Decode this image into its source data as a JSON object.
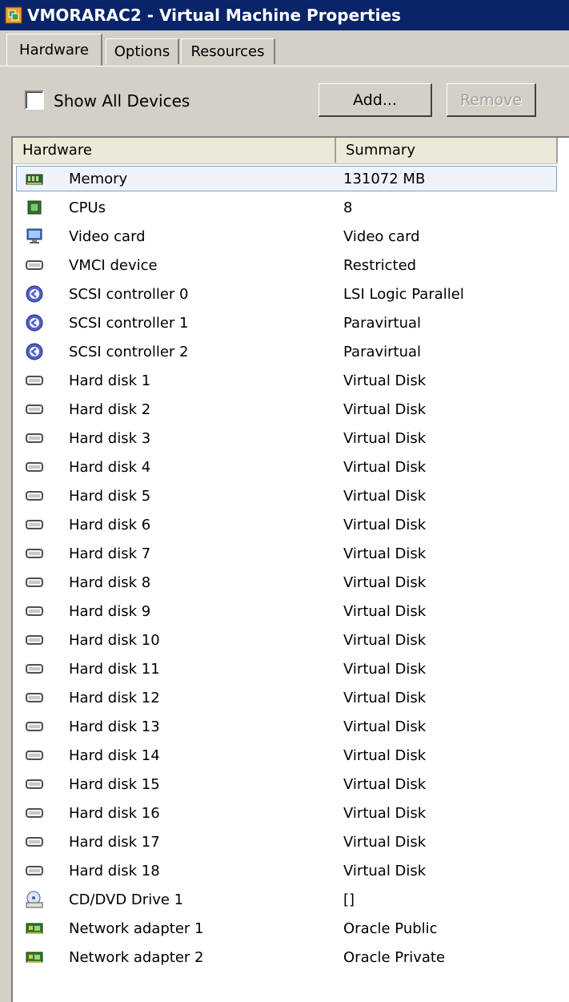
{
  "window": {
    "title": "VMORARAC2 - Virtual Machine Properties"
  },
  "tabs": [
    {
      "label": "Hardware",
      "active": true
    },
    {
      "label": "Options",
      "active": false
    },
    {
      "label": "Resources",
      "active": false
    }
  ],
  "toolbar": {
    "show_all_label": "Show All Devices",
    "show_all_checked": false,
    "add_label": "Add...",
    "remove_label": "Remove"
  },
  "columns": {
    "hardware": "Hardware",
    "summary": "Summary"
  },
  "devices": [
    {
      "name": "Memory",
      "summary": "131072 MB",
      "icon": "memory-icon",
      "selected": true
    },
    {
      "name": "CPUs",
      "summary": "8",
      "icon": "cpu-icon"
    },
    {
      "name": "Video card",
      "summary": "Video card",
      "icon": "monitor-icon"
    },
    {
      "name": "VMCI device",
      "summary": "Restricted",
      "icon": "disk-icon"
    },
    {
      "name": "SCSI controller 0",
      "summary": "LSI Logic Parallel",
      "icon": "scsi-icon"
    },
    {
      "name": "SCSI controller 1",
      "summary": "Paravirtual",
      "icon": "scsi-icon"
    },
    {
      "name": "SCSI controller 2",
      "summary": "Paravirtual",
      "icon": "scsi-icon"
    },
    {
      "name": "Hard disk 1",
      "summary": "Virtual Disk",
      "icon": "disk-icon"
    },
    {
      "name": "Hard disk 2",
      "summary": "Virtual Disk",
      "icon": "disk-icon"
    },
    {
      "name": "Hard disk 3",
      "summary": "Virtual Disk",
      "icon": "disk-icon"
    },
    {
      "name": "Hard disk 4",
      "summary": "Virtual Disk",
      "icon": "disk-icon"
    },
    {
      "name": "Hard disk 5",
      "summary": "Virtual Disk",
      "icon": "disk-icon"
    },
    {
      "name": "Hard disk 6",
      "summary": "Virtual Disk",
      "icon": "disk-icon"
    },
    {
      "name": "Hard disk 7",
      "summary": "Virtual Disk",
      "icon": "disk-icon"
    },
    {
      "name": "Hard disk 8",
      "summary": "Virtual Disk",
      "icon": "disk-icon"
    },
    {
      "name": "Hard disk 9",
      "summary": "Virtual Disk",
      "icon": "disk-icon"
    },
    {
      "name": "Hard disk 10",
      "summary": "Virtual Disk",
      "icon": "disk-icon"
    },
    {
      "name": "Hard disk 11",
      "summary": "Virtual Disk",
      "icon": "disk-icon"
    },
    {
      "name": "Hard disk 12",
      "summary": "Virtual Disk",
      "icon": "disk-icon"
    },
    {
      "name": "Hard disk 13",
      "summary": "Virtual Disk",
      "icon": "disk-icon"
    },
    {
      "name": "Hard disk 14",
      "summary": "Virtual Disk",
      "icon": "disk-icon"
    },
    {
      "name": "Hard disk 15",
      "summary": "Virtual Disk",
      "icon": "disk-icon"
    },
    {
      "name": "Hard disk 16",
      "summary": "Virtual Disk",
      "icon": "disk-icon"
    },
    {
      "name": "Hard disk 17",
      "summary": "Virtual Disk",
      "icon": "disk-icon"
    },
    {
      "name": "Hard disk 18",
      "summary": "Virtual Disk",
      "icon": "disk-icon"
    },
    {
      "name": "CD/DVD Drive 1",
      "summary": "[]",
      "icon": "cd-dvd-icon"
    },
    {
      "name": "Network adapter 1",
      "summary": "Oracle Public",
      "icon": "network-adapter-icon"
    },
    {
      "name": "Network adapter 2",
      "summary": "Oracle Private",
      "icon": "network-adapter-icon"
    }
  ]
}
